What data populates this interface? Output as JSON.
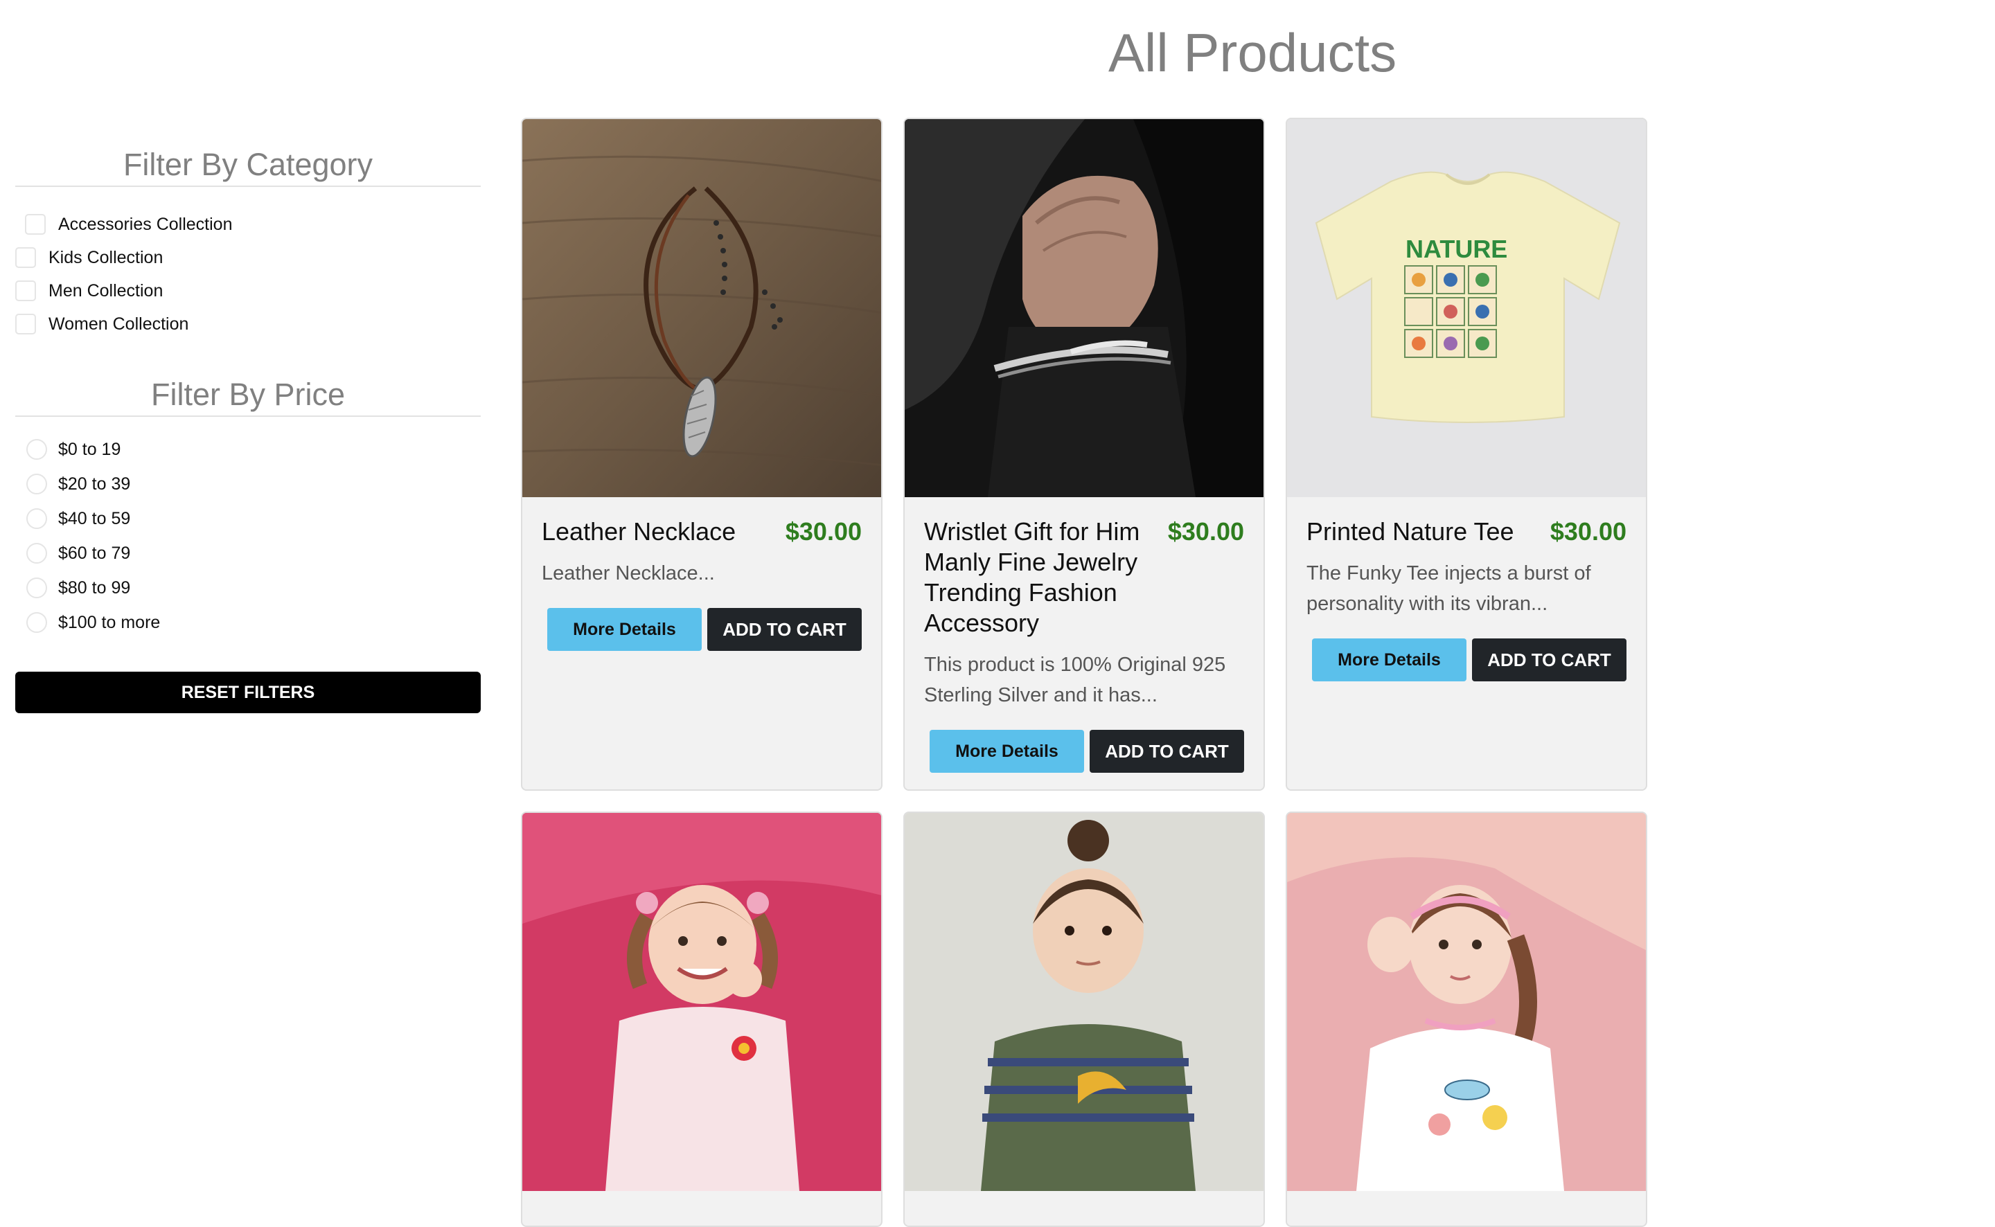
{
  "page": {
    "title": "All Products"
  },
  "sidebar": {
    "category_heading": "Filter By Category",
    "categories": [
      {
        "label": "Accessories Collection",
        "checked": false
      },
      {
        "label": "Kids Collection",
        "checked": false
      },
      {
        "label": "Men Collection",
        "checked": false
      },
      {
        "label": "Women Collection",
        "checked": false
      }
    ],
    "price_heading": "Filter By Price",
    "prices": [
      {
        "label": "$0 to 19",
        "checked": false
      },
      {
        "label": "$20 to 39",
        "checked": false
      },
      {
        "label": "$40 to 59",
        "checked": false
      },
      {
        "label": "$60 to 79",
        "checked": false
      },
      {
        "label": "$80 to 99",
        "checked": false
      },
      {
        "label": "$100 to more",
        "checked": false
      }
    ],
    "reset_label": "RESET FILTERS"
  },
  "products": [
    {
      "name": "Leather Necklace",
      "price": "$30.00",
      "description": "Leather Necklace...",
      "details_label": "More Details",
      "cart_label": "ADD TO CART",
      "image": "necklace-photo"
    },
    {
      "name": "Wristlet Gift for Him Manly Fine Jewelry Trending Fashion Accessory",
      "price": "$30.00",
      "description": "This product is 100% Original 925 Sterling Silver and it has...",
      "details_label": "More Details",
      "cart_label": "ADD TO CART",
      "image": "bracelet-photo"
    },
    {
      "name": "Printed Nature Tee",
      "price": "$30.00",
      "description": "The Funky Tee injects a burst of personality with its vibran...",
      "details_label": "More Details",
      "cart_label": "ADD TO CART",
      "image": "nature-tee-photo"
    }
  ],
  "partial_products": [
    {
      "image": "girl-pink-background-photo"
    },
    {
      "image": "child-striped-shirt-photo"
    },
    {
      "image": "girl-headband-photo"
    }
  ],
  "print_text": {
    "nature_word": "NATURE"
  },
  "colors": {
    "price": "#2e7d1e",
    "details_button": "#5bc0eb",
    "cart_button": "#212529",
    "reset_button": "#000000",
    "heading": "#808080"
  }
}
